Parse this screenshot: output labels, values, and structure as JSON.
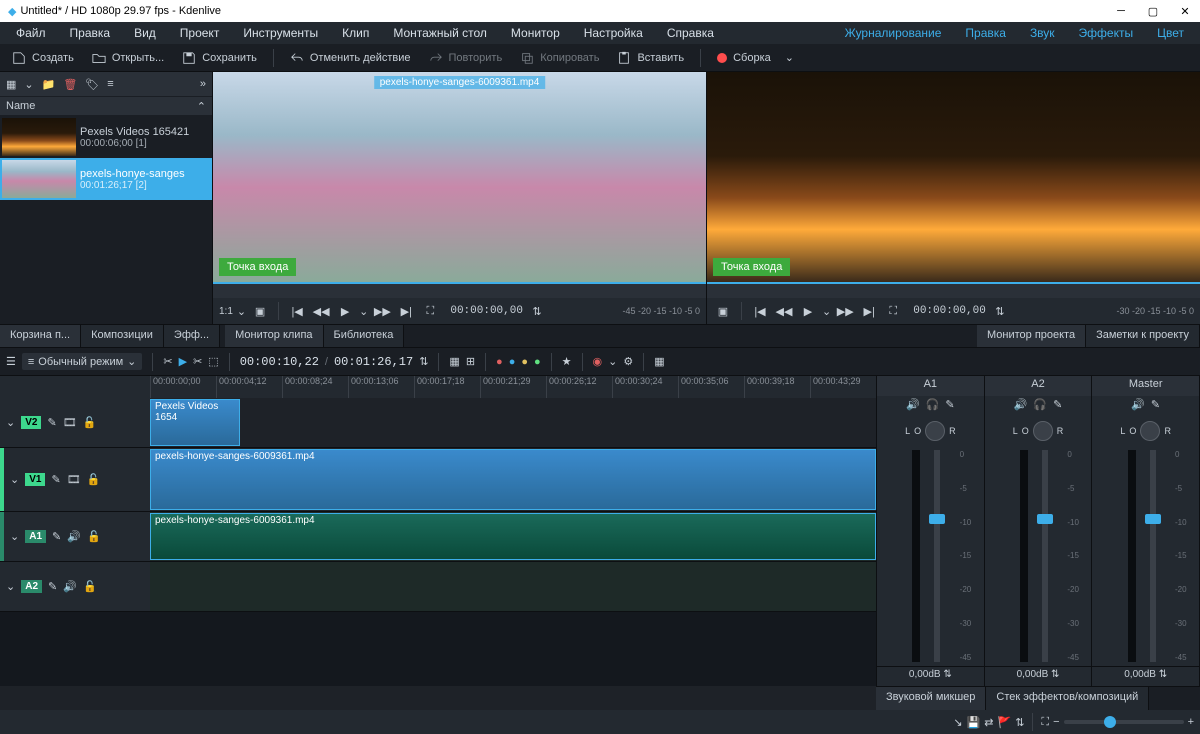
{
  "title": "Untitled* / HD 1080p 29.97 fps - Kdenlive",
  "menu": {
    "left": [
      "Файл",
      "Правка",
      "Вид",
      "Проект",
      "Инструменты",
      "Клип",
      "Монтажный стол",
      "Монитор",
      "Настройка",
      "Справка"
    ],
    "right": [
      "Журналирование",
      "Правка",
      "Звук",
      "Эффекты",
      "Цвет"
    ]
  },
  "toolbar": {
    "create": "Создать",
    "open": "Открыть...",
    "save": "Сохранить",
    "undo": "Отменить действие",
    "redo": "Повторить",
    "copy": "Копировать",
    "paste": "Вставить",
    "render": "Сборка"
  },
  "bin": {
    "header": "Name",
    "clips": [
      {
        "name": "Pexels Videos 165421",
        "dur": "00:00:06;00 [1]"
      },
      {
        "name": "pexels-honye-sanges",
        "dur": "00:01:26;17 [2]"
      }
    ]
  },
  "monitor": {
    "inpoint": "Точка входа",
    "overlayfile": "pexels-honye-sanges-6009361.mp4",
    "ratio": "1:1",
    "clip_tc": "00:00:00,00",
    "proj_tc": "00:00:00,00",
    "marks": "-45  -20  -15  -10  -5  0",
    "marks2": "-30  -20  -15  -10  -5  0"
  },
  "tabs_left": [
    "Корзина п...",
    "Композиции",
    "Эфф..."
  ],
  "tabs_mid": [
    "Монитор клипа",
    "Библиотека"
  ],
  "tabs_right": [
    "Монитор проекта",
    "Заметки к проекту"
  ],
  "timeline": {
    "mode": "Обычный режим",
    "pos": "00:00:10,22",
    "dur": "00:01:26,17",
    "ticks": [
      "00:00:00;00",
      "00:00:04;12",
      "00:00:08;24",
      "00:00:13;06",
      "00:00:17;18",
      "00:00:21;29",
      "00:00:26;12",
      "00:00:30;24",
      "00:00:35;06",
      "00:00:39;18",
      "00:00:43;29"
    ],
    "tracks": {
      "v2": "V2",
      "v1": "V1",
      "a1": "A1",
      "a2": "A2"
    },
    "clip_v2": "Pexels Videos 1654",
    "clip_v1": "pexels-honye-sanges-6009361.mp4",
    "clip_a1": "pexels-honye-sanges-6009361.mp4"
  },
  "mixer": {
    "a1": "A1",
    "a2": "A2",
    "master": "Master",
    "l": "L",
    "o": "O",
    "r": "R",
    "db": "0,00dB",
    "levels": [
      "0",
      "-5",
      "-10",
      "-15",
      "-20",
      "-30",
      "-45"
    ]
  },
  "bottom_tabs": [
    "Звуковой микшер",
    "Стек эффектов/композиций"
  ]
}
